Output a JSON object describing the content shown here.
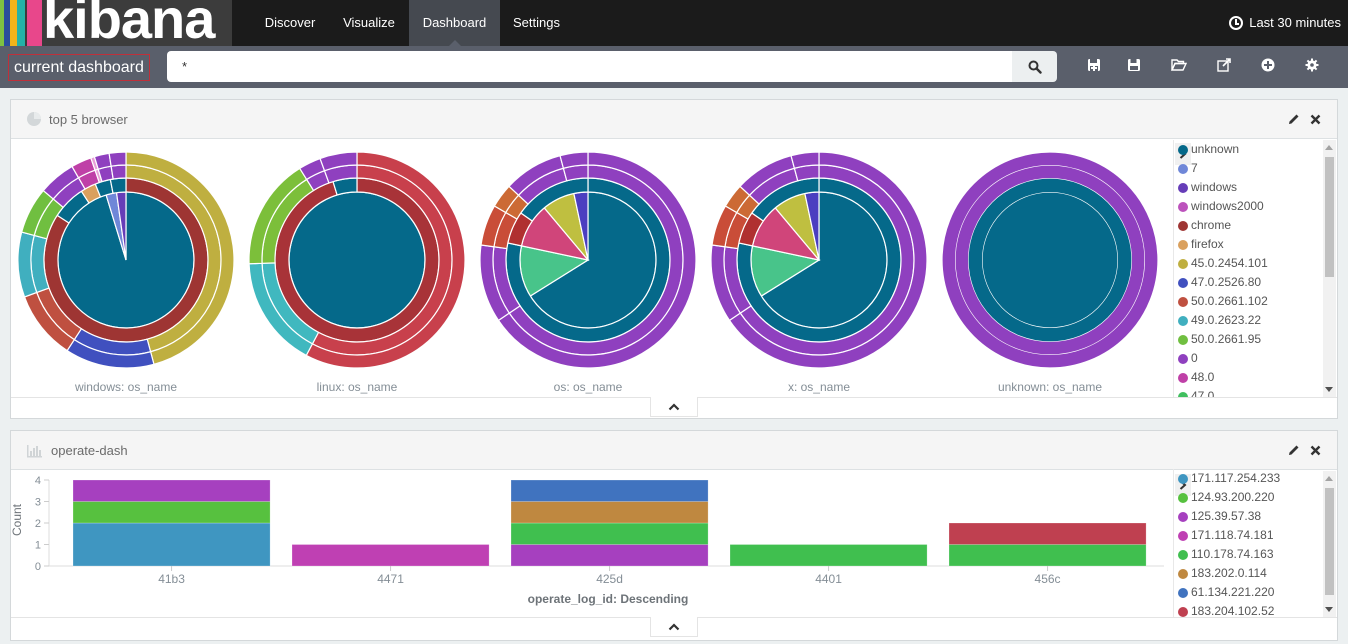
{
  "app": {
    "logo_text": "kibana",
    "logo_stripes": [
      "#7ec242",
      "#2a4e9c",
      "#f2b41a",
      "#24b2a8",
      "#e8478b"
    ]
  },
  "nav": {
    "items": [
      {
        "label": "Discover",
        "active": false
      },
      {
        "label": "Visualize",
        "active": false
      },
      {
        "label": "Dashboard",
        "active": true
      },
      {
        "label": "Settings",
        "active": false
      }
    ],
    "timepicker": "Last 30 minutes"
  },
  "dashboard": {
    "title": "current dashboard",
    "query": "*",
    "toolbar": [
      "new-dashboard-icon",
      "save-icon",
      "open-icon",
      "share-icon",
      "add-visualization-icon",
      "options-gear-icon"
    ]
  },
  "panels": {
    "pie": {
      "title": "top 5 browser",
      "legend": [
        {
          "label": "unknown",
          "color": "#05698a"
        },
        {
          "label": "7",
          "color": "#6f87d8"
        },
        {
          "label": "windows",
          "color": "#663db8"
        },
        {
          "label": "windows2000",
          "color": "#bc52bc"
        },
        {
          "label": "chrome",
          "color": "#9e3533"
        },
        {
          "label": "firefox",
          "color": "#daa05d"
        },
        {
          "label": "45.0.2454.101",
          "color": "#bfaf40"
        },
        {
          "label": "47.0.2526.80",
          "color": "#4050bf"
        },
        {
          "label": "50.0.2661.102",
          "color": "#bf5040"
        },
        {
          "label": "49.0.2623.22",
          "color": "#40afbf"
        },
        {
          "label": "50.0.2661.95",
          "color": "#70bf40"
        },
        {
          "label": "0",
          "color": "#8f40bf"
        },
        {
          "label": "48.0",
          "color": "#bf40a7"
        },
        {
          "label": "47.0",
          "color": "#40bf5f"
        }
      ]
    },
    "bar": {
      "title": "operate-dash",
      "legend": [
        {
          "label": "171.117.254.233",
          "color": "#3f96c1"
        },
        {
          "label": "124.93.200.220",
          "color": "#57c13f"
        },
        {
          "label": "125.39.57.38",
          "color": "#a640bf"
        },
        {
          "label": "171.118.74.181",
          "color": "#bf40b3"
        },
        {
          "label": "110.178.74.163",
          "color": "#40bf4f"
        },
        {
          "label": "183.202.0.114",
          "color": "#bf8840"
        },
        {
          "label": "61.134.221.220",
          "color": "#4073bf"
        },
        {
          "label": "183.204.102.52",
          "color": "#bf4050"
        }
      ]
    }
  },
  "chart_data": [
    {
      "type": "pie",
      "title": "top 5 browser",
      "subtype": "multi-ring (sunburst), slices listed clockwise from top, values in degrees-of-total (360)",
      "charts": [
        {
          "label": "windows: os_name",
          "rings": [
            [
              [
                "#05698a",
                343
              ],
              [
                "#6f87d8",
                9
              ],
              [
                "#663db8",
                8
              ]
            ],
            [
              [
                "#9e3533",
                303
              ],
              [
                "#05698a",
                24
              ],
              [
                "#daa05d",
                11
              ],
              [
                "#05698a",
                11
              ],
              [
                "#05698a",
                11
              ]
            ],
            [
              [
                "#bfaf40",
                165
              ],
              [
                "#4050bf",
                48
              ],
              [
                "#bf5040",
                37
              ],
              [
                "#40afbf",
                35
              ],
              [
                "#70bf40",
                25
              ],
              [
                "#8f40bf",
                20
              ],
              [
                "#bf40a7",
                11
              ],
              [
                "#e8a0d8",
                2
              ],
              [
                "#8f40bf",
                8
              ],
              [
                "#8f40bf",
                9
              ]
            ],
            [
              [
                "#bfaf40",
                165
              ],
              [
                "#4050bf",
                48
              ],
              [
                "#bf5040",
                37
              ],
              [
                "#40afbf",
                35
              ],
              [
                "#70bf40",
                25
              ],
              [
                "#8f40bf",
                20
              ],
              [
                "#bf40a7",
                11
              ],
              [
                "#e8a0d8",
                2
              ],
              [
                "#8f40bf",
                8
              ],
              [
                "#8f40bf",
                9
              ]
            ]
          ]
        },
        {
          "label": "linux: os_name",
          "rings": [
            [
              [
                "#05698a",
                360
              ]
            ],
            [
              [
                "#a83338",
                343
              ],
              [
                "#05698a",
                17
              ]
            ],
            [
              [
                "#c8404c",
                208
              ],
              [
                "#40b8bf",
                60
              ],
              [
                "#7cbf3a",
                60
              ],
              [
                "#8f40bf",
                12
              ],
              [
                "#8f40bf",
                20
              ]
            ],
            [
              [
                "#c8404c",
                208
              ],
              [
                "#40b8bf",
                60
              ],
              [
                "#7cbf3a",
                60
              ],
              [
                "#8f40bf",
                12
              ],
              [
                "#8f40bf",
                20
              ]
            ]
          ]
        },
        {
          "label": "os: os_name",
          "rings": [
            [
              [
                "#05698a",
                238
              ],
              [
                "#48c48a",
                44
              ],
              [
                "#d0457a",
                38
              ],
              [
                "#bfbf40",
                28
              ],
              [
                "#4b3fc0",
                12
              ]
            ],
            [
              [
                "#05698a",
                282
              ],
              [
                "#b03030",
                23
              ],
              [
                "#05698a",
                55
              ]
            ],
            [
              [
                "#8f40bf",
                236
              ],
              [
                "#8f40bf",
                42
              ],
              [
                "#c94d38",
                22
              ],
              [
                "#cc6a35",
                13
              ],
              [
                "#8f40bf",
                32
              ],
              [
                "#8f40bf",
                15
              ]
            ],
            [
              [
                "#8f40bf",
                236
              ],
              [
                "#8f40bf",
                42
              ],
              [
                "#c94d38",
                22
              ],
              [
                "#cc6a35",
                13
              ],
              [
                "#8f40bf",
                32
              ],
              [
                "#8f40bf",
                15
              ]
            ]
          ]
        },
        {
          "label": "x: os_name",
          "rings": [
            [
              [
                "#05698a",
                238
              ],
              [
                "#48c48a",
                44
              ],
              [
                "#d0457a",
                38
              ],
              [
                "#bfbf40",
                28
              ],
              [
                "#4b3fc0",
                12
              ]
            ],
            [
              [
                "#05698a",
                282
              ],
              [
                "#b03030",
                23
              ],
              [
                "#05698a",
                55
              ]
            ],
            [
              [
                "#8f40bf",
                236
              ],
              [
                "#8f40bf",
                42
              ],
              [
                "#c94d38",
                22
              ],
              [
                "#cc6a35",
                13
              ],
              [
                "#8f40bf",
                32
              ],
              [
                "#8f40bf",
                15
              ]
            ],
            [
              [
                "#8f40bf",
                236
              ],
              [
                "#8f40bf",
                42
              ],
              [
                "#c94d38",
                22
              ],
              [
                "#cc6a35",
                13
              ],
              [
                "#8f40bf",
                32
              ],
              [
                "#8f40bf",
                15
              ]
            ]
          ]
        },
        {
          "label": "unknown: os_name",
          "rings": [
            [
              [
                "#05698a",
                360
              ]
            ],
            [
              [
                "#05698a",
                360
              ]
            ],
            [
              [
                "#8f40bf",
                360
              ]
            ],
            [
              [
                "#8f40bf",
                360
              ]
            ]
          ]
        }
      ]
    },
    {
      "type": "bar",
      "title": "operate-dash",
      "stacked": true,
      "xlabel": "operate_log_id: Descending",
      "ylabel": "Count",
      "ylim": [
        0,
        4
      ],
      "yticks": [
        0,
        1,
        2,
        3,
        4
      ],
      "categories": [
        "41b3",
        "4471",
        "425d",
        "4401",
        "456c"
      ],
      "stacks": [
        [
          [
            "171.117.254.233",
            2
          ],
          [
            "124.93.200.220",
            1
          ],
          [
            "125.39.57.38",
            1
          ]
        ],
        [
          [
            "171.118.74.181",
            1
          ]
        ],
        [
          [
            "125.39.57.38",
            1
          ],
          [
            "110.178.74.163",
            1
          ],
          [
            "183.202.0.114",
            1
          ],
          [
            "61.134.221.220",
            1
          ]
        ],
        [
          [
            "110.178.74.163",
            1
          ]
        ],
        [
          [
            "110.178.74.163",
            1
          ],
          [
            "183.204.102.52",
            1
          ]
        ]
      ]
    }
  ]
}
